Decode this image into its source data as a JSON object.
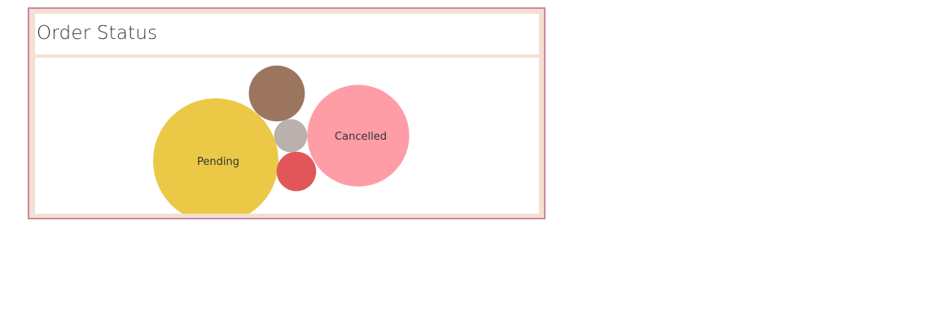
{
  "dashboard": {
    "title": "Order Status"
  },
  "chart_data": {
    "type": "bubble",
    "title": "Order Status",
    "series": [
      {
        "label": "Pending",
        "value": 100,
        "color": "#ebc947"
      },
      {
        "label": "Cancelled",
        "value": 66,
        "color": "#ff9da7"
      },
      {
        "label": "",
        "value": 20,
        "color": "#9c755f"
      },
      {
        "label": "",
        "value": 10,
        "color": "#e15759"
      },
      {
        "label": "",
        "value": 7,
        "color": "#bab0ac"
      }
    ]
  }
}
